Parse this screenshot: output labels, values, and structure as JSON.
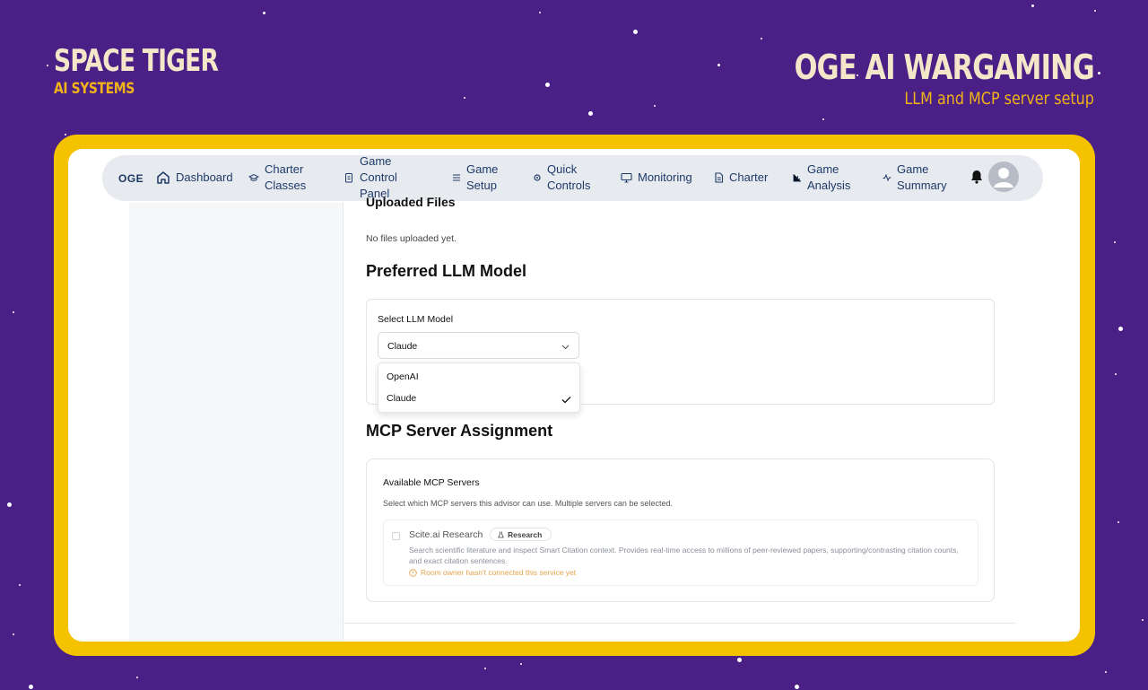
{
  "brand": {
    "name": "SPACE TIGER",
    "tagline": "AI SYSTEMS"
  },
  "hero": {
    "title": "OGE AI WARGAMING",
    "subtitle": "LLM and MCP server setup"
  },
  "nav": {
    "logo": "OGE",
    "items": [
      {
        "label": "Dashboard",
        "icon": "home-icon"
      },
      {
        "label": "Charter\nClasses",
        "icon": "graduation-cap-icon"
      },
      {
        "label": "Game\nControl\nPanel",
        "icon": "clipboard-icon"
      },
      {
        "label": "Game\nSetup",
        "icon": "list-icon"
      },
      {
        "label": "Quick\nControls",
        "icon": "gear-icon"
      },
      {
        "label": "Monitoring",
        "icon": "monitor-icon"
      },
      {
        "label": "Charter",
        "icon": "document-icon"
      },
      {
        "label": "Game\nAnalysis",
        "icon": "bar-chart-icon"
      },
      {
        "label": "Game\nSummary",
        "icon": "activity-icon"
      }
    ]
  },
  "uploaded": {
    "title": "Uploaded Files",
    "empty_text": "No files uploaded yet."
  },
  "llm": {
    "section_title": "Preferred LLM Model",
    "select_label": "Select LLM Model",
    "selected": "Claude",
    "options": [
      "OpenAI",
      "Claude"
    ]
  },
  "mcp": {
    "section_title": "MCP Server Assignment",
    "card_title": "Available MCP Servers",
    "card_description": "Select which MCP servers this advisor can use. Multiple servers can be selected.",
    "servers": [
      {
        "name": "Scite.ai Research",
        "badge": "Research",
        "description": "Search scientific literature and inspect Smart Citation context. Provides real-time access to millions of peer-reviewed papers, supporting/contrasting citation counts, and exact citation sentences.",
        "warning": "Room owner hasn't connected this service yet"
      }
    ]
  },
  "colors": {
    "background": "#4a1f86",
    "frame": "#f5c200",
    "accent": "#f1b318",
    "nav_text": "#1e3a6a",
    "warning": "#e3a34c"
  }
}
